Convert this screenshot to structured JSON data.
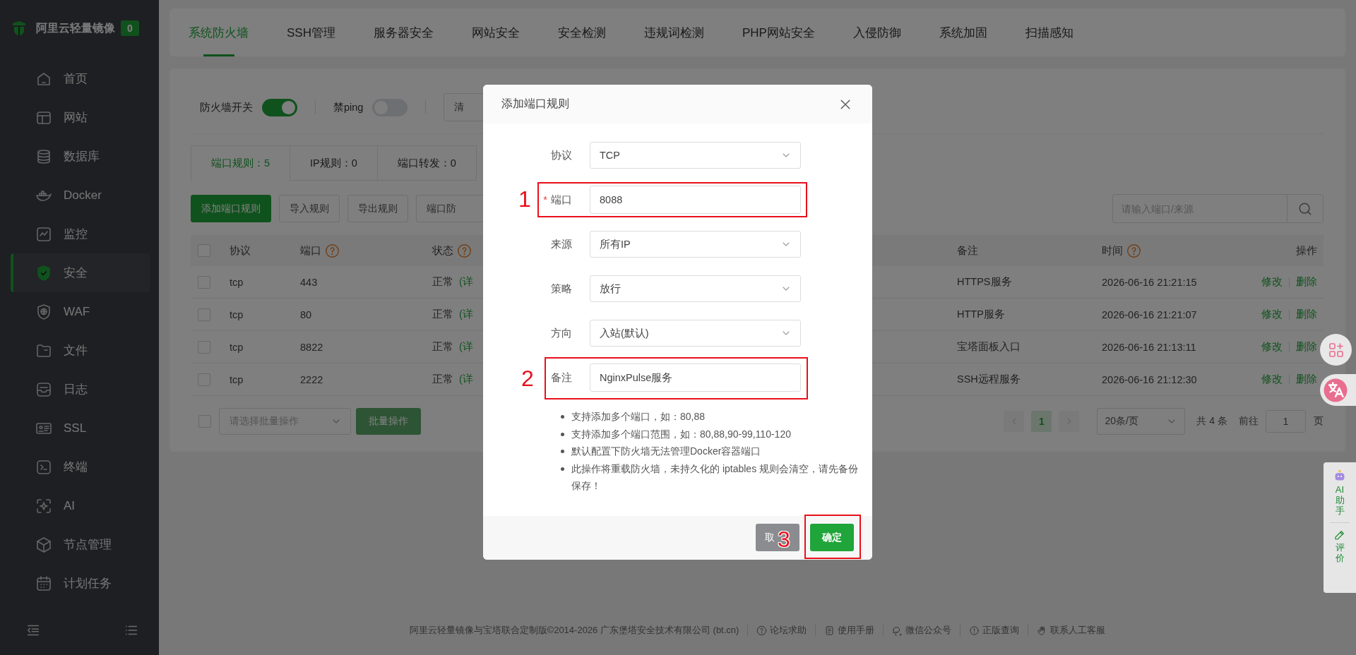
{
  "sidebar": {
    "title": "阿里云轻量镜像",
    "badge": "0",
    "items": [
      {
        "label": "首页",
        "selected": false
      },
      {
        "label": "网站",
        "selected": false
      },
      {
        "label": "数据库",
        "selected": false
      },
      {
        "label": "Docker",
        "selected": false
      },
      {
        "label": "监控",
        "selected": false
      },
      {
        "label": "安全",
        "selected": true
      },
      {
        "label": "WAF",
        "selected": false
      },
      {
        "label": "文件",
        "selected": false
      },
      {
        "label": "日志",
        "selected": false
      },
      {
        "label": "SSL",
        "selected": false
      },
      {
        "label": "终端",
        "selected": false
      },
      {
        "label": "AI",
        "selected": false
      },
      {
        "label": "节点管理",
        "selected": false
      },
      {
        "label": "计划任务",
        "selected": false
      }
    ]
  },
  "top_tabs": [
    {
      "label": "系统防火墙",
      "selected": true
    },
    {
      "label": "SSH管理",
      "selected": false
    },
    {
      "label": "服务器安全",
      "selected": false
    },
    {
      "label": "网站安全",
      "selected": false
    },
    {
      "label": "安全检测",
      "selected": false
    },
    {
      "label": "违规词检测",
      "selected": false
    },
    {
      "label": "PHP网站安全",
      "selected": false
    },
    {
      "label": "入侵防御",
      "selected": false
    },
    {
      "label": "系统加固",
      "selected": false
    },
    {
      "label": "扫描感知",
      "selected": false
    }
  ],
  "toolbar": {
    "switches": [
      {
        "label": "防火墙开关",
        "on": true
      },
      {
        "label": "禁ping",
        "on": false
      }
    ],
    "button": "清"
  },
  "rule_tabs": [
    {
      "label": "端口规则：5",
      "selected": true
    },
    {
      "label": "IP规则：0",
      "selected": false
    },
    {
      "label": "端口转发：0",
      "selected": false
    }
  ],
  "actions": [
    {
      "label": "添加端口规则",
      "kind": "primary"
    },
    {
      "label": "导入规则",
      "kind": "plain"
    },
    {
      "label": "导出规则",
      "kind": "plain"
    },
    {
      "label": "端口防",
      "kind": "plain"
    }
  ],
  "search": {
    "placeholder": "请输入端口/来源"
  },
  "table": {
    "columns": [
      {
        "label": "协议",
        "help": false
      },
      {
        "label": "端口",
        "help": true
      },
      {
        "label": "状态",
        "help": true
      },
      {
        "label": "备注",
        "help": false
      },
      {
        "label": "时间",
        "help": true
      },
      {
        "label": "操作",
        "help": false
      }
    ],
    "header_checked": false,
    "rows": [
      {
        "checked": false,
        "protocol": "tcp",
        "port": "443",
        "status": "正常",
        "detail": "(详",
        "remark": "HTTPS服务",
        "time": "2026-06-16 21:21:15",
        "actions": [
          "修改",
          "删除"
        ]
      },
      {
        "checked": false,
        "protocol": "tcp",
        "port": "80",
        "status": "正常",
        "detail": "(详",
        "remark": "HTTP服务",
        "time": "2026-06-16 21:21:07",
        "actions": [
          "修改",
          "删除"
        ]
      },
      {
        "checked": false,
        "protocol": "tcp",
        "port": "8822",
        "status": "正常",
        "detail": "(详",
        "remark": "宝塔面板入口",
        "time": "2026-06-16 21:13:11",
        "actions": [
          "修改",
          "删除"
        ]
      },
      {
        "checked": false,
        "protocol": "tcp",
        "port": "2222",
        "status": "正常",
        "detail": "(详",
        "remark": "SSH远程服务",
        "time": "2026-06-16 21:12:30",
        "actions": [
          "修改",
          "删除"
        ]
      }
    ]
  },
  "batch": {
    "checked": false,
    "placeholder": "请选择批量操作",
    "button": "批量操作",
    "disabled": true
  },
  "pagination": {
    "pages": [
      {
        "label": "1",
        "selected": true
      }
    ],
    "page_size": "20条/页",
    "total": "共 4 条",
    "goto_label": "前往",
    "goto_value": "1",
    "unit": "页"
  },
  "footer": {
    "copyright": "阿里云轻量镜像与宝塔联合定制版©2014-2026 广东堡塔安全技术有限公司 (bt.cn)",
    "links": [
      "论坛求助",
      "使用手册",
      "微信公众号",
      "正版查询",
      "联系人工客服"
    ]
  },
  "float_tools": {
    "assistant": "AI助手",
    "review": "评价"
  },
  "dialog": {
    "title": "添加端口规则",
    "fields": [
      {
        "label": "协议",
        "kind": "select",
        "value": "TCP",
        "required": false
      },
      {
        "label": "端口",
        "kind": "input",
        "value": "8088",
        "required": true,
        "required_mark": "*",
        "annotation": "1"
      },
      {
        "label": "来源",
        "kind": "select",
        "value": "所有IP",
        "required": false
      },
      {
        "label": "策略",
        "kind": "select",
        "value": "放行",
        "required": false
      },
      {
        "label": "方向",
        "kind": "select",
        "value": "入站(默认)",
        "required": false
      },
      {
        "label": "备注",
        "kind": "input",
        "value": "NginxPulse服务",
        "required": false,
        "annotation": "2"
      }
    ],
    "notes": [
      "支持添加多个端口，如：80,88",
      "支持添加多个端口范围，如：80,88,90-99,110-120",
      "默认配置下防火墙无法管理Docker容器端口",
      "此操作将重载防火墙，未持久化的 iptables 规则会清空，请先备份保存！"
    ],
    "buttons": [
      {
        "label": "取",
        "kind": "cancel"
      },
      {
        "label": "确定",
        "kind": "confirm",
        "annotation": "3"
      }
    ]
  }
}
